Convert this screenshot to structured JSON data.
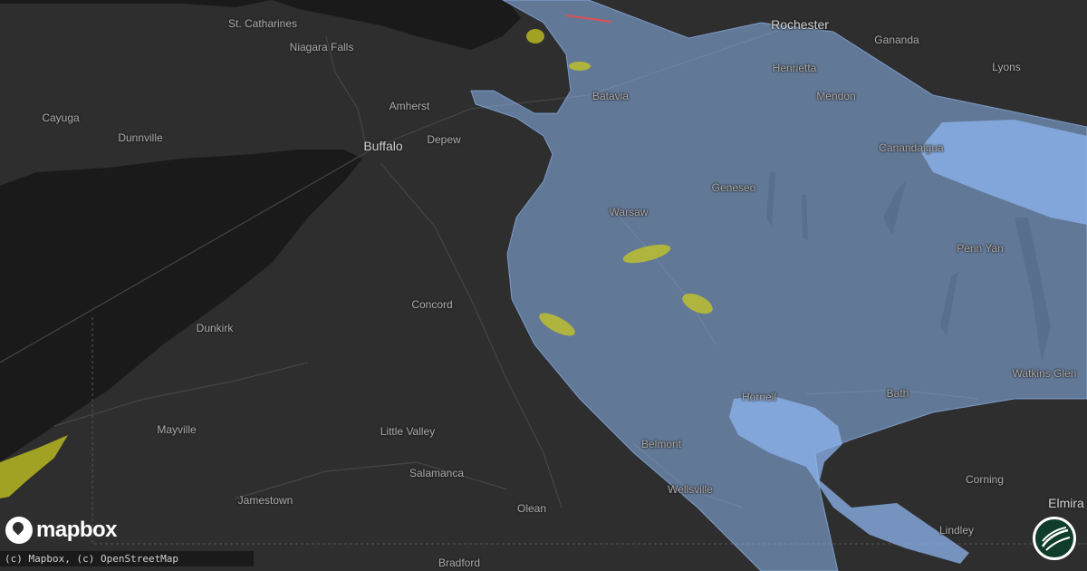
{
  "map": {
    "colors": {
      "land": "#2e2e2e",
      "water": "#1a1a1a",
      "road": "#4a4a4a",
      "hail_zone": "#8eb6ef",
      "warning_zone": "#c8c820",
      "severe_line": "#e05050"
    },
    "labels": [
      {
        "text": "St. Catharines",
        "major": false
      },
      {
        "text": "Niagara Falls",
        "major": false
      },
      {
        "text": "Cayuga",
        "major": false
      },
      {
        "text": "Dunnville",
        "major": false
      },
      {
        "text": "Amherst",
        "major": false
      },
      {
        "text": "Buffalo",
        "major": true
      },
      {
        "text": "Depew",
        "major": false
      },
      {
        "text": "Batavia",
        "major": false
      },
      {
        "text": "Rochester",
        "major": true
      },
      {
        "text": "Henrietta",
        "major": false
      },
      {
        "text": "Mendon",
        "major": false
      },
      {
        "text": "Gananda",
        "major": false
      },
      {
        "text": "Lyons",
        "major": false
      },
      {
        "text": "Canandaigua",
        "major": false
      },
      {
        "text": "Geneseo",
        "major": false
      },
      {
        "text": "Warsaw",
        "major": false
      },
      {
        "text": "Penn Yan",
        "major": false
      },
      {
        "text": "Concord",
        "major": false
      },
      {
        "text": "Dunkirk",
        "major": false
      },
      {
        "text": "Watkins Glen",
        "major": false
      },
      {
        "text": "Hornell",
        "major": false
      },
      {
        "text": "Bath",
        "major": false
      },
      {
        "text": "Mayville",
        "major": false
      },
      {
        "text": "Little Valley",
        "major": false
      },
      {
        "text": "Belmont",
        "major": false
      },
      {
        "text": "Salamanca",
        "major": false
      },
      {
        "text": "Wellsville",
        "major": false
      },
      {
        "text": "Jamestown",
        "major": false
      },
      {
        "text": "Olean",
        "major": false
      },
      {
        "text": "Corning",
        "major": false
      },
      {
        "text": "Elmira",
        "major": true
      },
      {
        "text": "Lindley",
        "major": false
      },
      {
        "text": "Bradford",
        "major": false
      }
    ]
  },
  "branding": {
    "logo_text": "mapbox",
    "logo_icon": "mapbox-pin-icon",
    "badge_icon": "hail-brand-icon"
  },
  "attribution": {
    "text": "(c) Mapbox, (c) OpenStreetMap"
  }
}
